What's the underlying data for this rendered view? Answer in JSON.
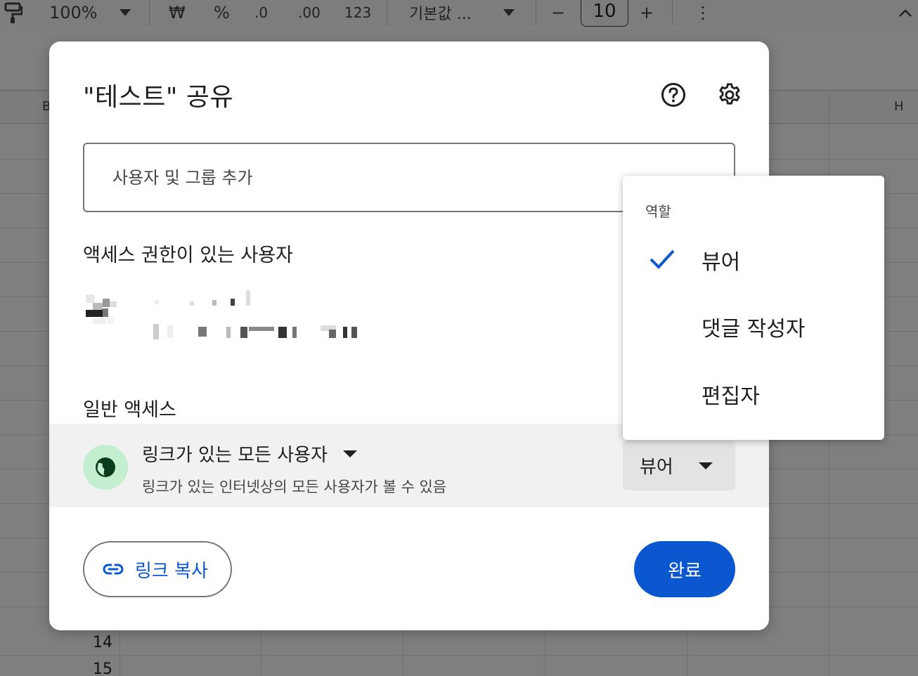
{
  "toolbar": {
    "zoom": "100%",
    "currency": "₩",
    "percent": "%",
    "decrease_decimal": ".0",
    "increase_decimal": ".00",
    "number_format": "123",
    "font": "기본값 ...",
    "minus": "−",
    "font_size": "10",
    "plus": "+",
    "more": "⋮",
    "collapse": "^"
  },
  "sheet": {
    "col_b": "B",
    "col_h": "H",
    "rows": [
      "14",
      "15"
    ]
  },
  "dialog": {
    "title": "\"테스트\" 공유",
    "add_placeholder": "사용자 및 그룹 추가",
    "people_heading": "액세스 권한이 있는 사용자",
    "general_heading": "일반 액세스",
    "general_access": {
      "scope": "링크가 있는 모든 사용자",
      "description": "링크가 있는 인터넷상의 모든 사용자가 볼 수 있음",
      "role": "뷰어"
    },
    "copy_link_label": "링크 복사",
    "done_label": "완료"
  },
  "role_menu": {
    "heading": "역할",
    "items": [
      {
        "label": "뷰어",
        "selected": true
      },
      {
        "label": "댓글 작성자",
        "selected": false
      },
      {
        "label": "편집자",
        "selected": false
      }
    ]
  },
  "colors": {
    "accent": "#0b57d0",
    "globe_bg": "#c4eed0",
    "row_highlight": "#f1f1f1"
  }
}
